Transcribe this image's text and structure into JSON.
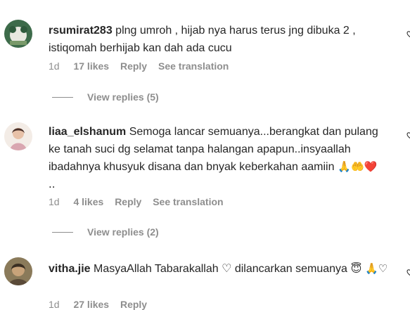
{
  "comments": [
    {
      "username": "rsumirat283",
      "text": "plng umroh , hijab nya harus terus jng dibuka 2 , istiqomah berhijab kan dah ada cucu",
      "emojis": "",
      "time": "1d",
      "likes": "17 likes",
      "reply": "Reply",
      "see_translation": "See translation",
      "view_replies": "View replies (5)"
    },
    {
      "username": "liaa_elshanum",
      "text": "Semoga lancar semuanya...berangkat dan pulang ke tanah suci dg selamat tanpa halangan apapun..insyaallah ibadahnya khusyuk disana dan bnyak keberkahan aamiin",
      "emojis": " 🙏🤲❤️ ..",
      "time": "1d",
      "likes": "4 likes",
      "reply": "Reply",
      "see_translation": "See translation",
      "view_replies": "View replies (2)"
    },
    {
      "username": "vitha.jie",
      "text": "MasyaAllah Tabarakallah ♡ dilancarkan semuanya",
      "emojis": " 😇 🙏♡",
      "time": "1d",
      "likes": "27 likes",
      "reply": "Reply"
    }
  ]
}
